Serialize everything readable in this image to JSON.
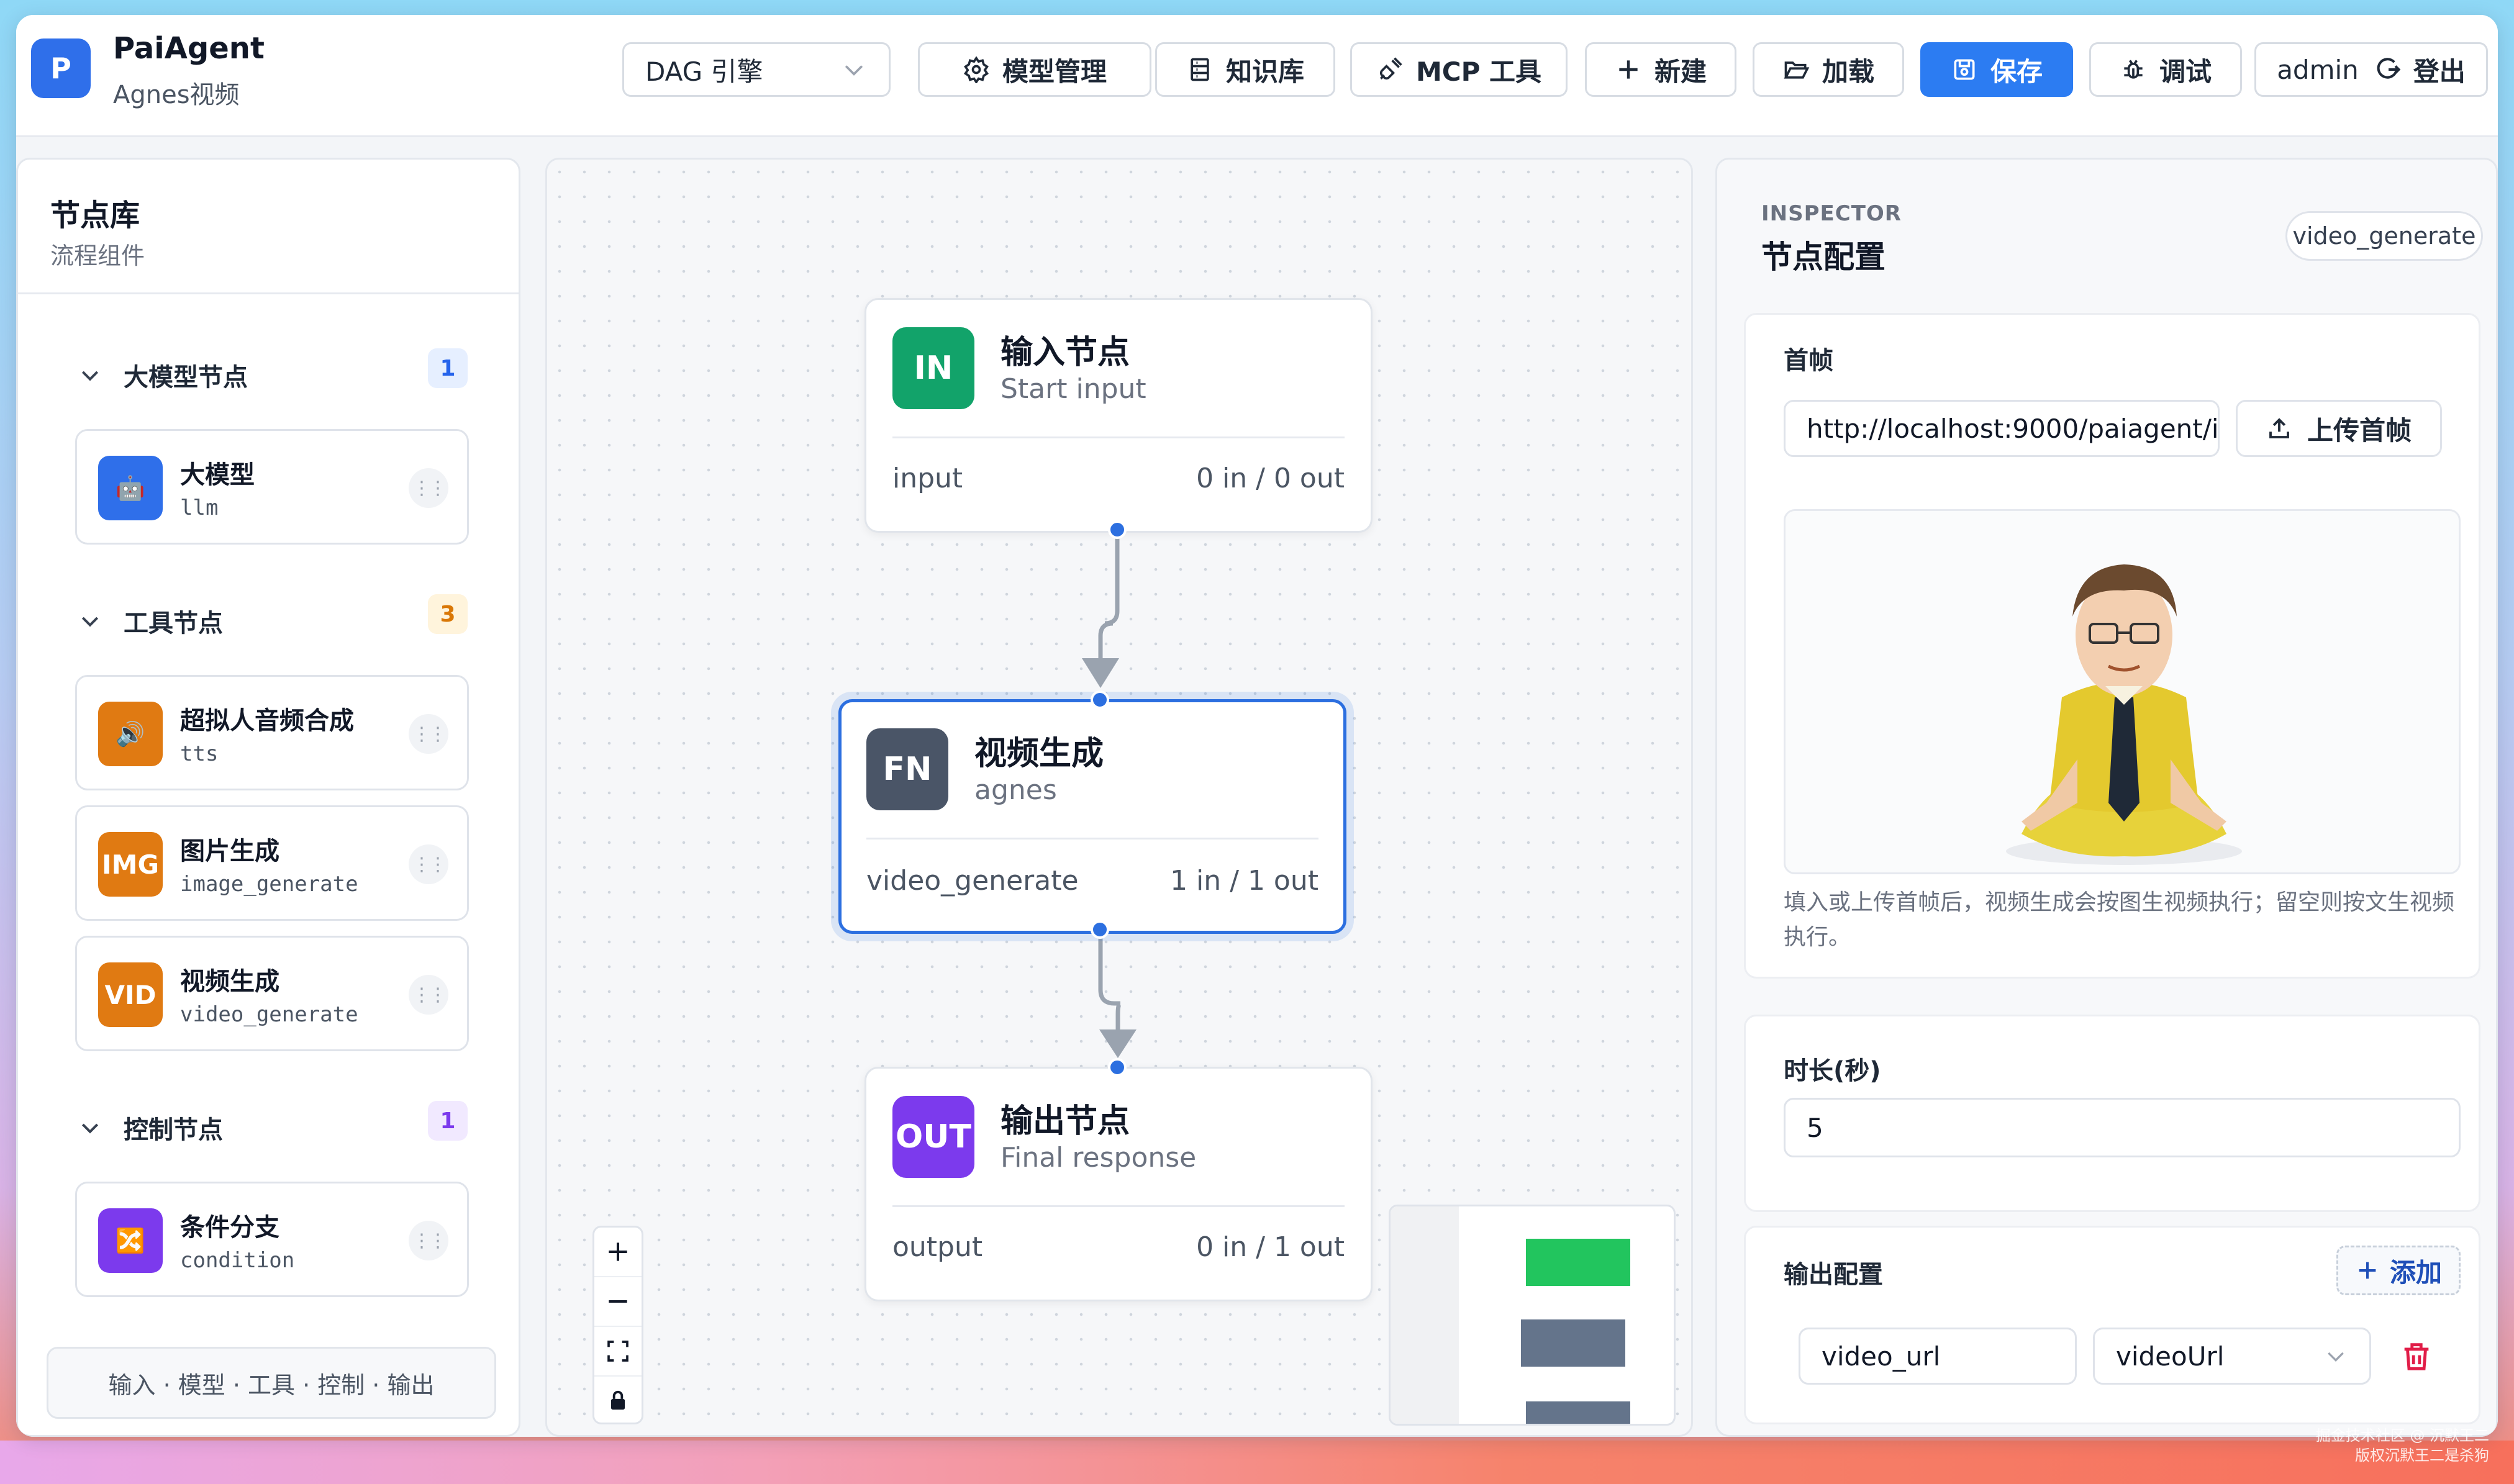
{
  "app": {
    "logo_letter": "P",
    "title": "PaiAgent",
    "subtitle": "Agnes视频"
  },
  "toolbar": {
    "engine_value": "DAG 引擎",
    "model_mgmt": "模型管理",
    "knowledge": "知识库",
    "mcp": "MCP 工具",
    "new": "新建",
    "load": "加载",
    "save": "保存",
    "debug": "调试",
    "user": "admin",
    "logout": "登出"
  },
  "library": {
    "title": "节点库",
    "subtitle": "流程组件",
    "groups": [
      {
        "label": "大模型节点",
        "count": "1",
        "badge_color": "#2563eb",
        "badge_bg": "#e6efff",
        "items": [
          {
            "name": "大模型",
            "code": "llm",
            "icon": "robot-icon",
            "icon_text": "🤖",
            "color": "#2f6fea"
          }
        ]
      },
      {
        "label": "工具节点",
        "count": "3",
        "badge_color": "#d97706",
        "badge_bg": "#fff4dc",
        "items": [
          {
            "name": "超拟人音频合成",
            "code": "tts",
            "icon": "speaker-icon",
            "icon_text": "🔊",
            "color": "#e07a12"
          },
          {
            "name": "图片生成",
            "code": "image_generate",
            "icon": "image-icon",
            "icon_text": "IMG",
            "color": "#e07a12"
          },
          {
            "name": "视频生成",
            "code": "video_generate",
            "icon": "video-icon",
            "icon_text": "VID",
            "color": "#e07a12"
          }
        ]
      },
      {
        "label": "控制节点",
        "count": "1",
        "badge_color": "#7c3aed",
        "badge_bg": "#f1e9ff",
        "items": [
          {
            "name": "条件分支",
            "code": "condition",
            "icon": "shuffle-icon",
            "icon_text": "🔀",
            "color": "#7c3aed"
          }
        ]
      }
    ],
    "footer": "输入 · 模型 · 工具 · 控制 · 输出"
  },
  "flow": {
    "nodes": [
      {
        "badge": "IN",
        "title": "输入节点",
        "subtitle": "Start input",
        "key": "input",
        "io": "0 in / 0 out",
        "color": "#12a36a"
      },
      {
        "badge": "FN",
        "title": "视频生成",
        "subtitle": "agnes",
        "key": "video_generate",
        "io": "1 in / 1 out",
        "color": "#4a5567"
      },
      {
        "badge": "OUT",
        "title": "输出节点",
        "subtitle": "Final response",
        "key": "output",
        "io": "0 in / 1 out",
        "color": "#7c3aed"
      }
    ]
  },
  "inspector": {
    "caption": "INSPECTOR",
    "title": "节点配置",
    "node_tag": "video_generate",
    "first_frame_label": "首帧",
    "first_frame_url": "http://localhost:9000/paiagent/i",
    "upload_label": "上传首帧",
    "help_text": "填入或上传首帧后，视频生成会按图生视频执行；留空则按文生视频执行。",
    "duration_label": "时长(秒)",
    "duration_value": "5",
    "output_label": "输出配置",
    "add_label": "添加",
    "output_name": "video_url",
    "output_source": "videoUrl"
  },
  "watermark": [
    "掘金技术社区 @ 沉默王二",
    "版权沉默王二是杀狗"
  ]
}
